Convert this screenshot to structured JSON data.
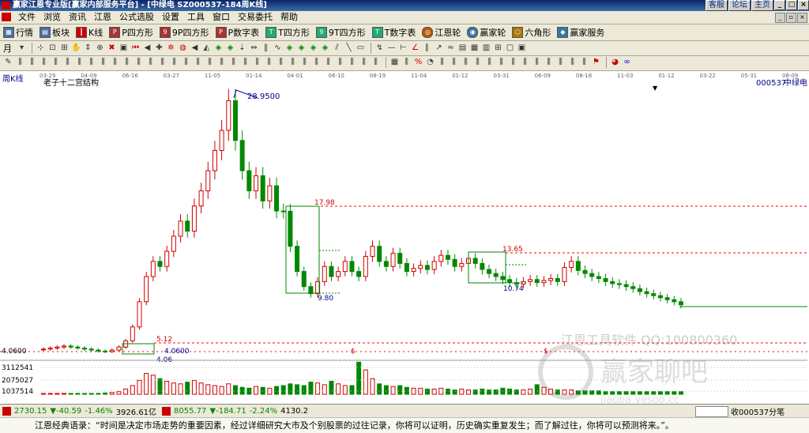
{
  "titlebar": {
    "title": "赢家江恩专业版[赢家内部服务平台] - [中绿电  SZ000537-184周K线]",
    "buttons": [
      "客服",
      "论坛",
      "主页"
    ]
  },
  "menu": [
    "文件",
    "浏览",
    "资讯",
    "江恩",
    "公式选股",
    "设置",
    "工具",
    "窗口",
    "交易委托",
    "帮助"
  ],
  "toolbar1": [
    {
      "label": "行情",
      "icon": "quote-table-icon"
    },
    {
      "label": "板块",
      "icon": "sector-icon"
    },
    {
      "label": "K线",
      "icon": "candle-icon"
    },
    {
      "label": "P四方形",
      "icon": "p-square-icon"
    },
    {
      "label": "9P四方形",
      "icon": "9p-square-icon"
    },
    {
      "label": "P数字表",
      "icon": "p-number-table-icon"
    },
    {
      "label": "T四方形",
      "icon": "t-square-icon"
    },
    {
      "label": "9T四方形",
      "icon": "9t-square-icon"
    },
    {
      "label": "T数字表",
      "icon": "t-number-table-icon"
    },
    {
      "label": "江恩轮",
      "icon": "gann-wheel-icon"
    },
    {
      "label": "赢家轮",
      "icon": "winner-wheel-icon"
    },
    {
      "label": "六角形",
      "icon": "hexagon-icon"
    },
    {
      "label": "赢家服务",
      "icon": "service-icon"
    }
  ],
  "toolbar2": {
    "period": "月"
  },
  "chart": {
    "period_label": "周K线",
    "indicator_label": "老子十二宫结构",
    "stock_code": "000537",
    "stock_name": "中绿电",
    "date_ticks": [
      "03-29",
      "04-09",
      "06-16",
      "03-27",
      "11-05",
      "01-14",
      "04-01",
      "06-10",
      "08-19",
      "11-04",
      "01-12",
      "03-31",
      "06-09",
      "08-18",
      "11-03",
      "01-12",
      "03-22",
      "05-31",
      "08-09"
    ],
    "annotations": {
      "peak": "28.9500",
      "box1_high": "17.98",
      "box1_low": "9.80",
      "box2_high": "13.65",
      "box2_low": "10.74",
      "base_high": "5.12",
      "base_low": "4.06",
      "base_mid": "4.0600",
      "left_price": "4.0600"
    },
    "volume_ticks": [
      "3112541",
      "2075027",
      "1037514"
    ],
    "markers": [
      "$",
      "$"
    ],
    "watermark": "江恩工具软件  QQ:100800360",
    "watermark_brand": "赢家聊吧",
    "watermark_sub": "jiaoba.yesoo.cc"
  },
  "colors": {
    "up": "#d00000",
    "down": "#008800",
    "frame": "#0000aa",
    "dashed": "#ff0000",
    "text_blue": "#000088"
  },
  "status": {
    "idx1_value": "2730.15",
    "idx1_change": "▼-40.59",
    "idx1_pct": "-1.46%",
    "idx1_amount": "3926.61亿",
    "idx2_value": "8055.77",
    "idx2_change": "▼-184.71",
    "idx2_pct": "-2.24%",
    "idx2_amount": "4130.2",
    "right_text": "收000537分笔"
  },
  "quote": "江恩经典语录：“时间是决定市场走势的重要因素，经过详细研究大市及个别股票的过往记录，你将可以证明，历史确实重复发生；而了解过往，你将可以预测将来。”。",
  "chart_data": {
    "type": "candlestick-weekly",
    "price_values": [
      4.3,
      4.4,
      4.5,
      4.6,
      4.5,
      4.4,
      4.3,
      4.2,
      4.1,
      4.06,
      4.2,
      4.5,
      5.12,
      6.5,
      9.0,
      11.5,
      13.0,
      12.5,
      14.0,
      15.5,
      17.0,
      16.0,
      18.5,
      20.0,
      22.0,
      24.0,
      26.0,
      28.95,
      25.0,
      22.0,
      20.0,
      21.5,
      19.0,
      20.5,
      18.0,
      17.98,
      14.5,
      12.0,
      10.5,
      9.8,
      11.0,
      12.5,
      11.5,
      12.0,
      13.0,
      12.0,
      11.5,
      13.5,
      14.5,
      13.0,
      12.5,
      13.8,
      12.8,
      12.0,
      12.3,
      12.6,
      12.2,
      13.0,
      13.6,
      13.2,
      12.5,
      12.8,
      13.3,
      12.8,
      12.2,
      11.8,
      11.5,
      11.2,
      10.9,
      10.74,
      11.0,
      11.2,
      10.9,
      11.1,
      11.3,
      11.0,
      12.4,
      13.0,
      12.1,
      11.8,
      11.5,
      11.3,
      11.0,
      10.8,
      10.7,
      10.5,
      10.3,
      10.0,
      9.8,
      9.6,
      9.4,
      9.2,
      9.0,
      8.7
    ],
    "volume_values": [
      0.1,
      0.1,
      0.1,
      0.1,
      0.1,
      0.1,
      0.1,
      0.1,
      0.1,
      0.15,
      0.2,
      0.3,
      0.6,
      1.0,
      1.6,
      2.4,
      2.2,
      1.8,
      1.5,
      1.3,
      1.2,
      1.4,
      1.6,
      1.3,
      1.1,
      1.0,
      0.9,
      1.2,
      1.0,
      0.8,
      0.7,
      0.9,
      0.8,
      0.7,
      0.9,
      1.0,
      1.2,
      1.1,
      1.0,
      1.4,
      1.3,
      1.1,
      1.5,
      1.2,
      1.0,
      1.0,
      3.7,
      2.8,
      1.8,
      1.2,
      1.0,
      0.9,
      1.0,
      0.8,
      0.7,
      0.7,
      0.6,
      0.6,
      0.7,
      0.6,
      0.5,
      0.6,
      0.5,
      0.5,
      0.6,
      0.5,
      0.5,
      0.7,
      0.6,
      0.5,
      0.5,
      0.6,
      1.1,
      0.8,
      0.6,
      0.5,
      0.5,
      0.5,
      0.4,
      0.4,
      0.4,
      0.4,
      0.3,
      0.3,
      0.3,
      0.3,
      0.3,
      0.3,
      0.3,
      0.3,
      0.3,
      0.3,
      0.3,
      0.3
    ],
    "volume_unit": "millions of shares (approx)"
  }
}
